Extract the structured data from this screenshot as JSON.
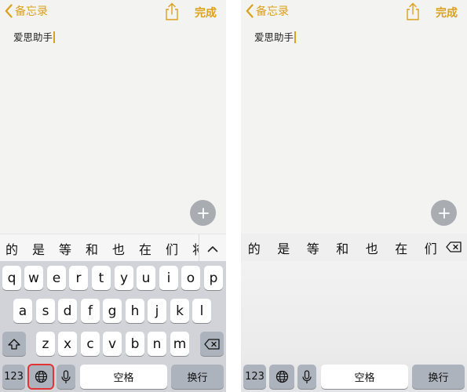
{
  "screens": [
    {
      "nav": {
        "back_label": "备忘录",
        "done_label": "完成"
      },
      "note": {
        "text": "爱思助手"
      },
      "candidates": [
        "的",
        "是",
        "等",
        "和",
        "也",
        "在",
        "们",
        "将"
      ],
      "keyboard": {
        "row1": [
          "q",
          "w",
          "e",
          "r",
          "t",
          "y",
          "u",
          "i",
          "o",
          "p"
        ],
        "row2": [
          "a",
          "s",
          "d",
          "f",
          "g",
          "h",
          "j",
          "k",
          "l"
        ],
        "row3": [
          "z",
          "x",
          "c",
          "v",
          "b",
          "n",
          "m"
        ],
        "numbers_label": "123",
        "space_label": "空格",
        "return_label": "换行",
        "highlighted_key": "globe-icon"
      }
    },
    {
      "nav": {
        "back_label": "备忘录",
        "done_label": "完成"
      },
      "note": {
        "text": "爱思助手"
      },
      "candidates": [
        "的",
        "是",
        "等",
        "和",
        "也",
        "在",
        "们"
      ],
      "keyboard": {
        "numbers_label": "123",
        "space_label": "空格",
        "return_label": "换行"
      }
    }
  ],
  "colors": {
    "accent": "#dba01c",
    "keyboard_bg": "#d1d3d9",
    "highlight": "#e23434"
  },
  "icons": [
    "chevron-left-icon",
    "share-icon",
    "plus-icon",
    "chevron-up-icon",
    "delete-icon",
    "shift-icon",
    "globe-icon",
    "microphone-icon"
  ]
}
